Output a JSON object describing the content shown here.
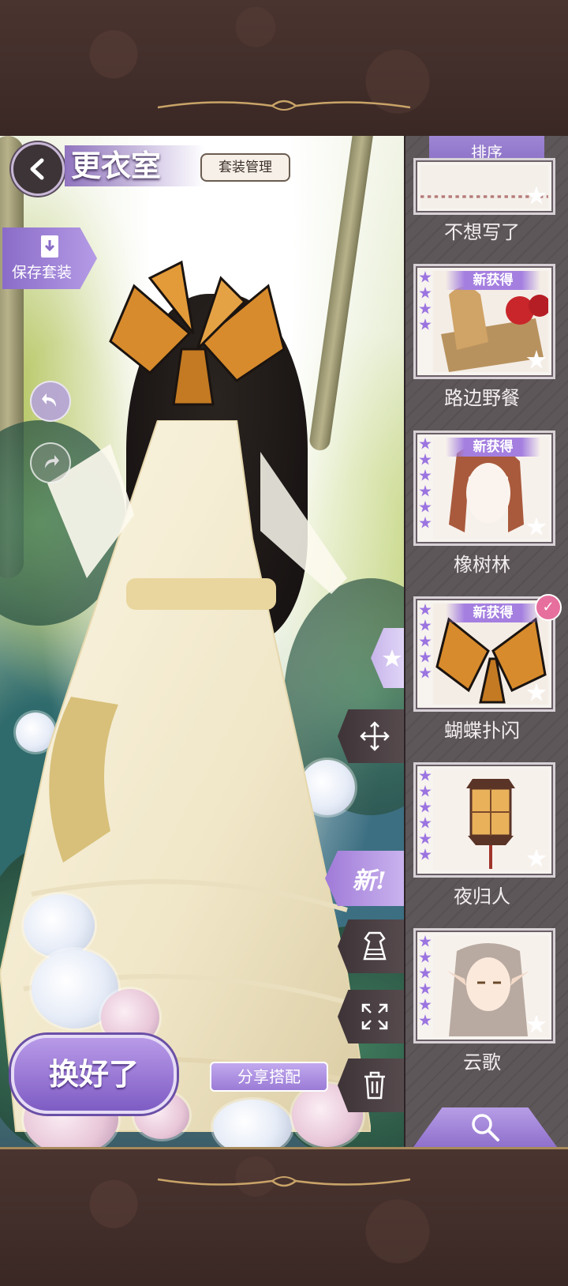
{
  "header": {
    "title": "更衣室",
    "suit_manage_label": "套装管理",
    "save_suit_label": "保存套装"
  },
  "actions": {
    "done_label": "换好了",
    "share_label": "分享搭配",
    "new_label": "新!"
  },
  "panel": {
    "sort_label": "排序",
    "new_tag_label": "新获得",
    "items": [
      {
        "name": "不想写了",
        "stars": 0,
        "new": false,
        "selected": false,
        "art": "lace-fabric"
      },
      {
        "name": "路边野餐",
        "stars": 4,
        "new": true,
        "selected": false,
        "art": "picnic-basket"
      },
      {
        "name": "橡树林",
        "stars": 6,
        "new": true,
        "selected": false,
        "art": "auburn-hair"
      },
      {
        "name": "蝴蝶扑闪",
        "stars": 5,
        "new": true,
        "selected": true,
        "art": "monarch-butterflies"
      },
      {
        "name": "夜归人",
        "stars": 6,
        "new": false,
        "selected": false,
        "art": "lantern"
      },
      {
        "name": "云歌",
        "stars": 6,
        "new": false,
        "selected": false,
        "art": "elf-portrait"
      }
    ]
  },
  "icons": {
    "back": "chevron-left-icon",
    "undo": "undo-icon",
    "redo": "redo-icon",
    "favorite": "star-icon",
    "move": "move-arrows-icon",
    "wardrobe": "dress-icon",
    "fullscreen": "expand-icon",
    "delete": "trash-icon",
    "search": "magnifier-icon",
    "selected": "checkmark-icon"
  },
  "colors": {
    "accent_purple": "#9b74e0",
    "panel_bg": "#5a5355",
    "frame_brown": "#3b2a26",
    "selected_pink": "#e66f9d"
  }
}
